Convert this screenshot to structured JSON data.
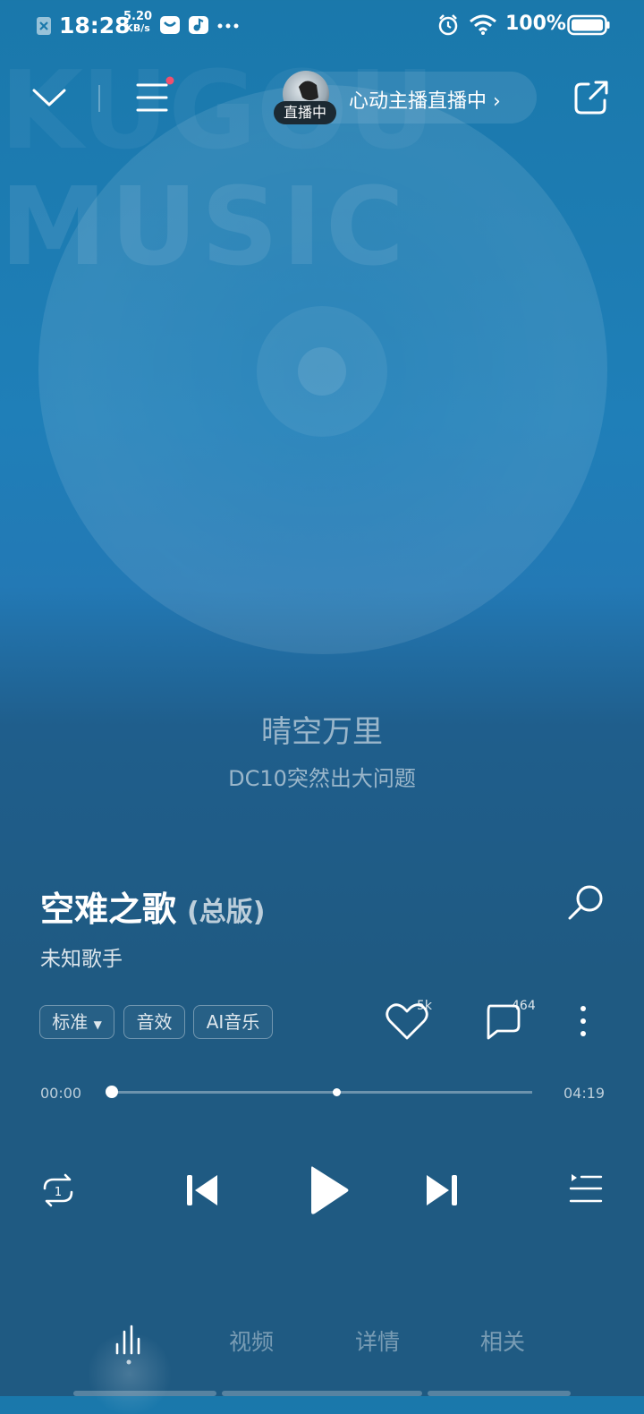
{
  "status_bar": {
    "time": "18:28",
    "speed_value": "5.20",
    "speed_unit": "KB/s",
    "battery": "100%"
  },
  "live": {
    "badge": "直播中",
    "text": "心动主播直播中 ›"
  },
  "background": {
    "text": "MUSIC",
    "text_top": "KUGOU"
  },
  "lyrics": {
    "current": "晴空万里",
    "next": "DC10突然出大问题"
  },
  "song": {
    "title": "空难之歌",
    "version": "(总版)",
    "artist": "未知歌手"
  },
  "chips": {
    "quality": "标准",
    "effects": "音效",
    "ai": "AI音乐"
  },
  "stats": {
    "likes": "5k",
    "comments": "464"
  },
  "progress": {
    "current": "00:00",
    "total": "04:19",
    "fraction": 0
  },
  "tabs": {
    "video": "视频",
    "details": "详情",
    "related": "相关"
  }
}
